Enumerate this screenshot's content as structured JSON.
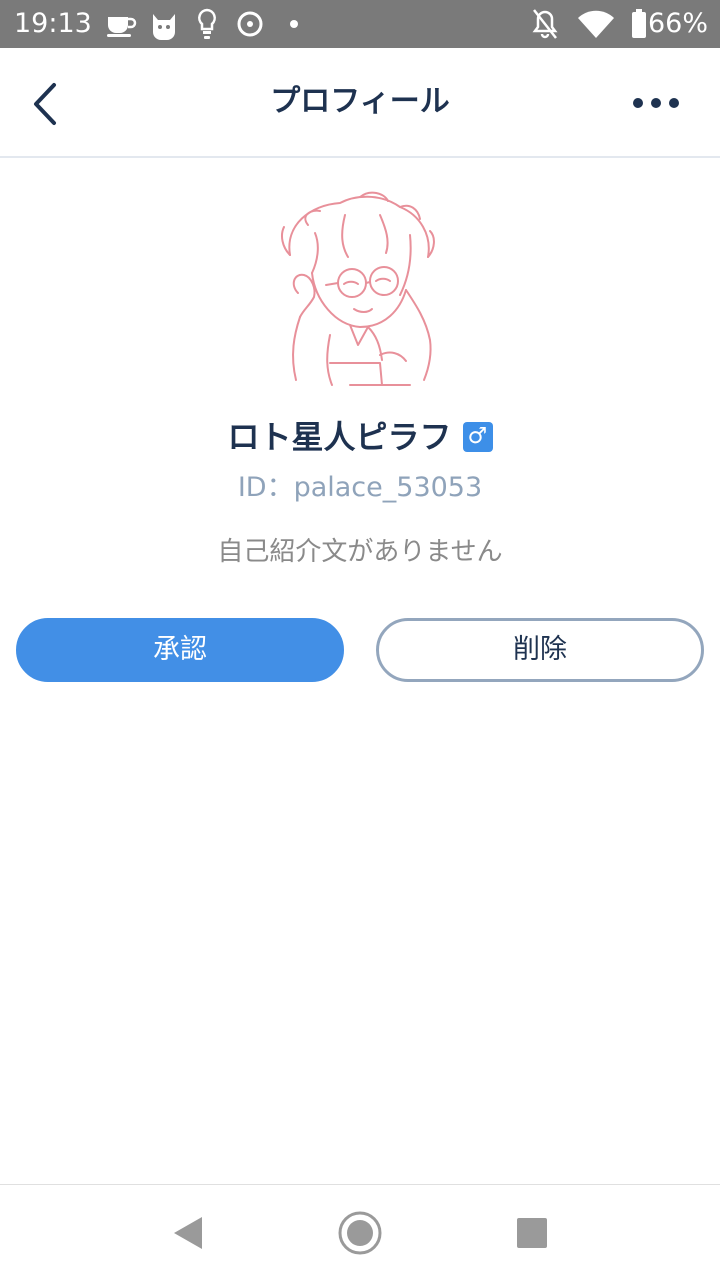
{
  "status_bar": {
    "time": "19:13",
    "battery": "66%",
    "icons": [
      "cup-icon",
      "cat-icon",
      "lightbulb-icon",
      "disc-icon",
      "dot-icon",
      "bell-off-icon",
      "wifi-icon",
      "battery-icon"
    ]
  },
  "header": {
    "title": "プロフィール",
    "back_icon": "chevron-left-icon",
    "more_icon": "more-dots-icon"
  },
  "profile": {
    "name": "ロト星人ピラフ",
    "gender_symbol": "♂",
    "id_text": "ID：palace_53053",
    "bio": "自己紹介文がありません"
  },
  "actions": {
    "approve_label": "承認",
    "delete_label": "削除"
  },
  "colors": {
    "accent": "#428fe6",
    "title_text": "#1e3250",
    "id_text": "#8fa3ba",
    "avatar_stroke": "#e8909a",
    "status_bar": "#7a7a7a"
  },
  "nav_bar": {
    "icons": [
      "nav-back-icon",
      "nav-home-icon",
      "nav-recents-icon"
    ]
  }
}
